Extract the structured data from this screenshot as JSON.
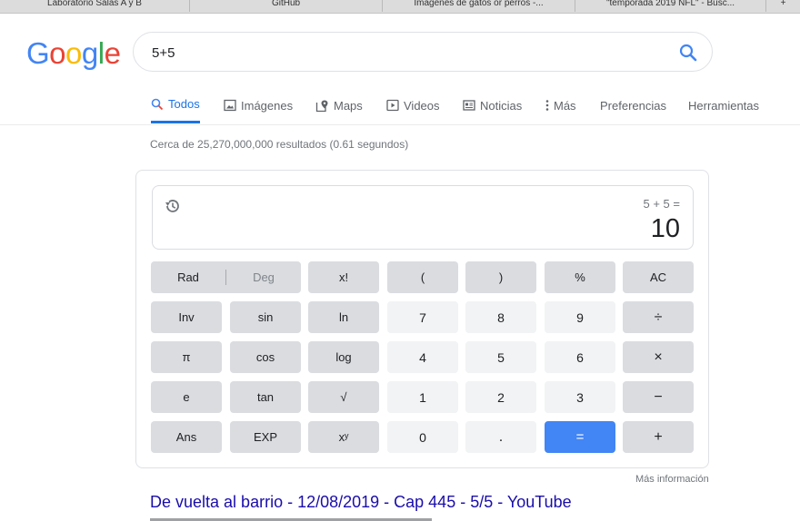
{
  "bookmarks": [
    {
      "label": "Laboratorio Salas A y B"
    },
    {
      "label": "GitHub"
    },
    {
      "label": "Imágenes de gatos or perros -..."
    },
    {
      "label": "\"temporada 2019 NFL\" - Busc..."
    },
    {
      "label": "+"
    }
  ],
  "search": {
    "query": "5+5"
  },
  "logo": {
    "letters": [
      "G",
      "o",
      "o",
      "g",
      "l",
      "e"
    ],
    "colors": [
      "#4285f4",
      "#ea4335",
      "#fbbc05",
      "#4285f4",
      "#34a853",
      "#ea4335"
    ]
  },
  "tabs": [
    {
      "label": "Todos",
      "icon": "search-icon"
    },
    {
      "label": "Imágenes",
      "icon": "image-icon"
    },
    {
      "label": "Maps",
      "icon": "map-icon"
    },
    {
      "label": "Videos",
      "icon": "play-icon"
    },
    {
      "label": "Noticias",
      "icon": "news-icon"
    },
    {
      "label": "Más",
      "icon": "more-vert-icon"
    },
    {
      "label": "Preferencias"
    },
    {
      "label": "Herramientas"
    }
  ],
  "stats": "Cerca de 25,270,000,000 resultados (0.61 segundos)",
  "calculator": {
    "expression": "5 + 5 =",
    "result": "10",
    "keys": {
      "rad": "Rad",
      "deg": "Deg",
      "fact": "x!",
      "lparen": "(",
      "rparen": ")",
      "percent": "%",
      "ac": "AC",
      "inv": "Inv",
      "sin": "sin",
      "ln": "ln",
      "k7": "7",
      "k8": "8",
      "k9": "9",
      "div": "÷",
      "pi": "π",
      "cos": "cos",
      "log": "log",
      "k4": "4",
      "k5": "5",
      "k6": "6",
      "mul": "×",
      "e": "e",
      "tan": "tan",
      "sqrt": "√",
      "k1": "1",
      "k2": "2",
      "k3": "3",
      "sub": "−",
      "ans": "Ans",
      "exp": "EXP",
      "pow": "xʸ",
      "k0": "0",
      "dot": ".",
      "eq": "=",
      "add": "+"
    },
    "more_info": "Más información"
  },
  "result": {
    "title": "De vuelta al barrio - 12/08/2019 - Cap 445 - 5/5 - YouTube"
  },
  "colors": {
    "accent": "#1a73e8",
    "link": "#1a0dab",
    "equals": "#4285f4"
  }
}
